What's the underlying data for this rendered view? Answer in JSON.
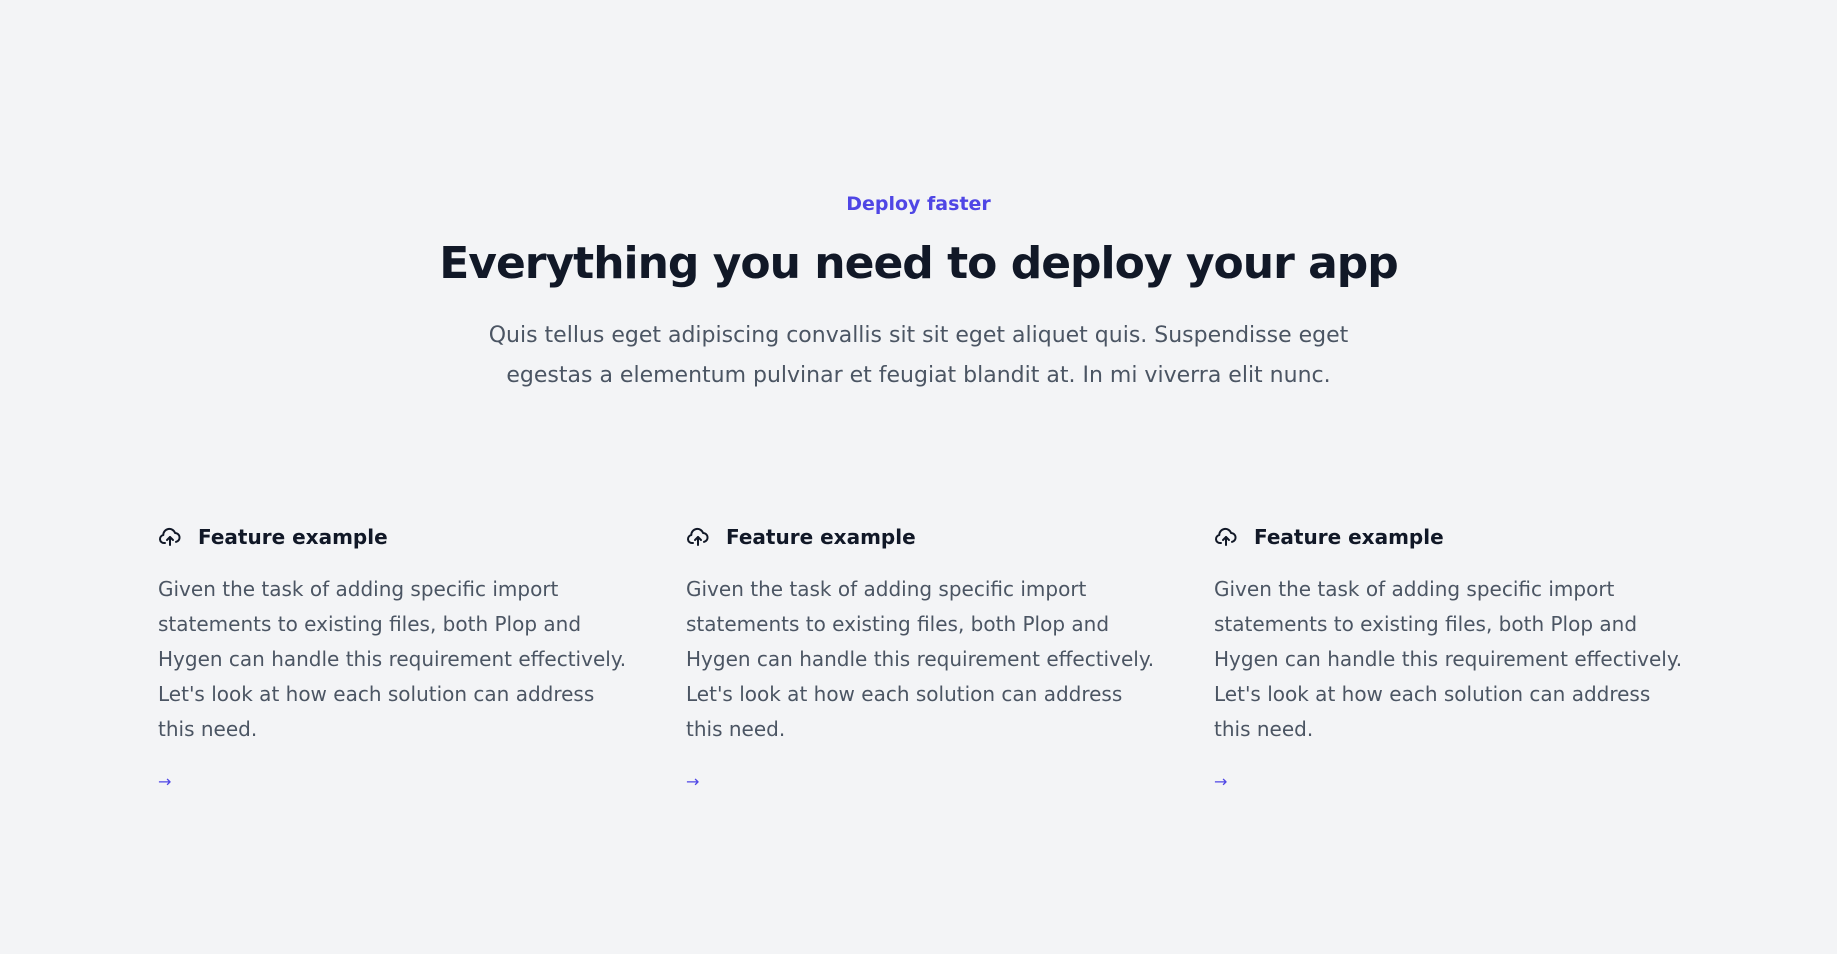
{
  "hero": {
    "eyebrow": "Deploy faster",
    "title": "Everything you need to deploy your app",
    "description": "Quis tellus eget adipiscing convallis sit sit eget aliquet quis. Suspendisse eget egestas a elementum pulvinar et feugiat blandit at. In mi viverra elit nunc."
  },
  "features": [
    {
      "icon": "cloud-upload-icon",
      "title": "Feature example",
      "description": "Given the task of adding specific import statements to existing files, both Plop and Hygen can handle this requirement effectively. Let's look at how each solution can address this need.",
      "link": "→"
    },
    {
      "icon": "cloud-upload-icon",
      "title": "Feature example",
      "description": "Given the task of adding specific import statements to existing files, both Plop and Hygen can handle this requirement effectively. Let's look at how each solution can address this need.",
      "link": "→"
    },
    {
      "icon": "cloud-upload-icon",
      "title": "Feature example",
      "description": "Given the task of adding specific import statements to existing files, both Plop and Hygen can handle this requirement effectively. Let's look at how each solution can address this need.",
      "link": "→"
    }
  ],
  "colors": {
    "background": "#f3f4f6",
    "accent": "#4f46e5",
    "heading": "#111827",
    "body": "#4b5563"
  }
}
